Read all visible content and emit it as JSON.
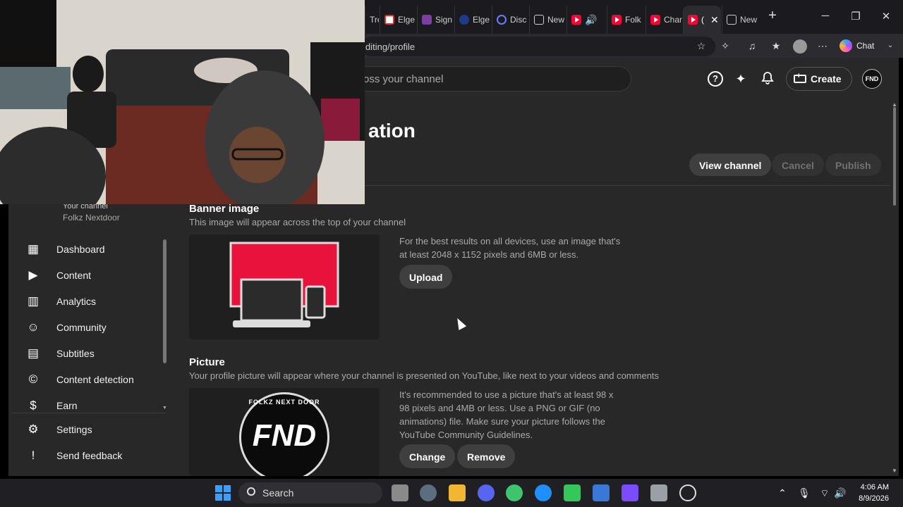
{
  "browser": {
    "tabs": [
      {
        "label": "Tre",
        "icon": "youtube-icon"
      },
      {
        "label": "Elge",
        "icon": "gmail-icon"
      },
      {
        "label": "Sign",
        "icon": "sign-icon"
      },
      {
        "label": "Elge",
        "icon": "globe-icon"
      },
      {
        "label": "Disc",
        "icon": "search-icon"
      },
      {
        "label": "New",
        "icon": "newtab-icon"
      },
      {
        "label": "",
        "icon": "youtube-audio-icon"
      },
      {
        "label": "Folk",
        "icon": "youtube-icon"
      },
      {
        "label": "Chan",
        "icon": "youtube-icon"
      },
      {
        "label": "(",
        "icon": "youtube-icon",
        "active": true
      },
      {
        "label": "New",
        "icon": "newtab-icon"
      }
    ],
    "url": "diting/profile",
    "copilot_label": "Chat"
  },
  "studio": {
    "search_placeholder": "oss your channel",
    "create_label": "Create",
    "avatar_text": "FND",
    "page_title": "ation",
    "view_channel_label": "View channel",
    "cancel_label": "Cancel",
    "publish_label": "Publish",
    "sidebar": {
      "channel_label": "Your channel",
      "channel_name": "Folkz Nextdoor",
      "items": [
        {
          "label": "Dashboard",
          "icon": "dashboard-icon"
        },
        {
          "label": "Content",
          "icon": "content-icon"
        },
        {
          "label": "Analytics",
          "icon": "analytics-icon"
        },
        {
          "label": "Community",
          "icon": "community-icon"
        },
        {
          "label": "Subtitles",
          "icon": "subtitles-icon"
        },
        {
          "label": "Content detection",
          "icon": "copyright-icon"
        },
        {
          "label": "Earn",
          "icon": "earn-icon"
        }
      ],
      "footer_items": [
        {
          "label": "Settings",
          "icon": "settings-icon"
        },
        {
          "label": "Send feedback",
          "icon": "feedback-icon"
        }
      ]
    },
    "banner": {
      "title": "Banner image",
      "subtitle": "This image will appear across the top of your channel",
      "description": "For the best results on all devices, use an image that's at least 2048 x 1152 pixels and 6MB or less.",
      "upload_label": "Upload"
    },
    "picture": {
      "title": "Picture",
      "subtitle": "Your profile picture will appear where your channel is presented on YouTube, like next to your videos and comments",
      "description": "It's recommended to use a picture that's at least 98 x 98 pixels and 4MB or less. Use a PNG or GIF (no animations) file. Make sure your picture follows the YouTube Community Guidelines.",
      "change_label": "Change",
      "remove_label": "Remove",
      "logo_text": "FND",
      "logo_ring_text": "FOLKZ NEXT DOOR"
    }
  },
  "taskbar": {
    "search_label": "Search",
    "time": "4:06 AM",
    "date": "8/9/2026"
  },
  "colors": {
    "youtube_red": "#ff0033",
    "banner_red": "#e8133d",
    "studio_bg": "#282828"
  }
}
